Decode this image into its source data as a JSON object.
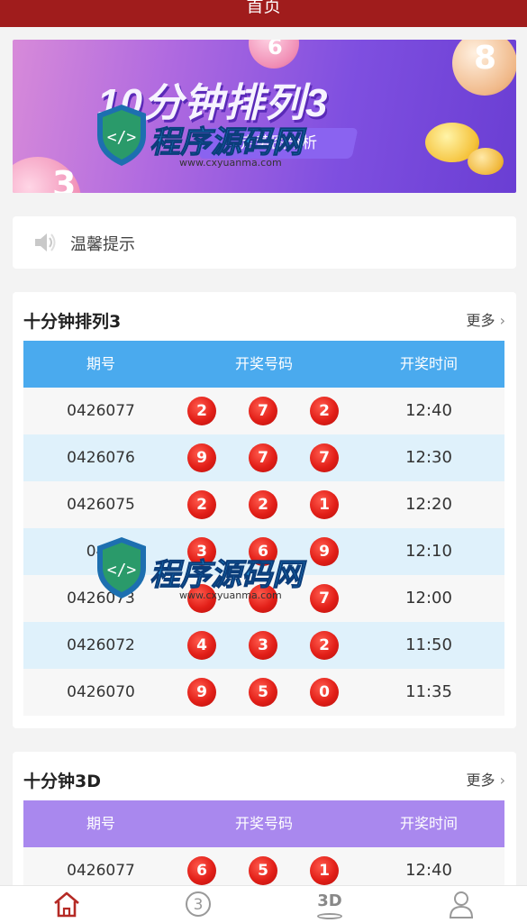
{
  "header": {
    "title": "首页"
  },
  "banner": {
    "title": "10分钟排列3",
    "subtitle": "走势图分析",
    "ball_numbers": [
      "8",
      "3",
      "6"
    ]
  },
  "watermark": {
    "text": "程序源码网",
    "url": "www.cxyuanma.com"
  },
  "notice": {
    "icon": "speaker-icon",
    "text": "温馨提示"
  },
  "sections": [
    {
      "title": "十分钟排列3",
      "more_label": "更多",
      "header_color": "#4aaaee",
      "columns": [
        "期号",
        "开奖号码",
        "开奖时间"
      ],
      "rows": [
        {
          "issue": "0426077",
          "balls": [
            "2",
            "7",
            "2"
          ],
          "time": "12:40"
        },
        {
          "issue": "0426076",
          "balls": [
            "9",
            "7",
            "7"
          ],
          "time": "12:30"
        },
        {
          "issue": "0426075",
          "balls": [
            "2",
            "2",
            "1"
          ],
          "time": "12:20"
        },
        {
          "issue": "042",
          "balls": [
            "3",
            "6",
            "9"
          ],
          "time": "12:10"
        },
        {
          "issue": "0426073",
          "balls": [
            "",
            "",
            "7"
          ],
          "time": "12:00"
        },
        {
          "issue": "0426072",
          "balls": [
            "4",
            "3",
            "2"
          ],
          "time": "11:50"
        },
        {
          "issue": "0426070",
          "balls": [
            "9",
            "5",
            "0"
          ],
          "time": "11:35"
        }
      ]
    },
    {
      "title": "十分钟3D",
      "more_label": "更多",
      "header_color": "#a988ee",
      "columns": [
        "期号",
        "开奖号码",
        "开奖时间"
      ],
      "rows": [
        {
          "issue": "0426077",
          "balls": [
            "6",
            "5",
            "1"
          ],
          "time": "12:40"
        }
      ]
    }
  ],
  "tabbar": [
    {
      "name": "home-icon",
      "active": true
    },
    {
      "name": "circled-three-icon",
      "active": false
    },
    {
      "name": "3d-icon",
      "label": "3D",
      "active": false
    },
    {
      "name": "user-icon",
      "active": false
    }
  ],
  "colors": {
    "brand": "#a01c1c",
    "ball": "#e21f18",
    "row_alt": "#dff1fb"
  }
}
